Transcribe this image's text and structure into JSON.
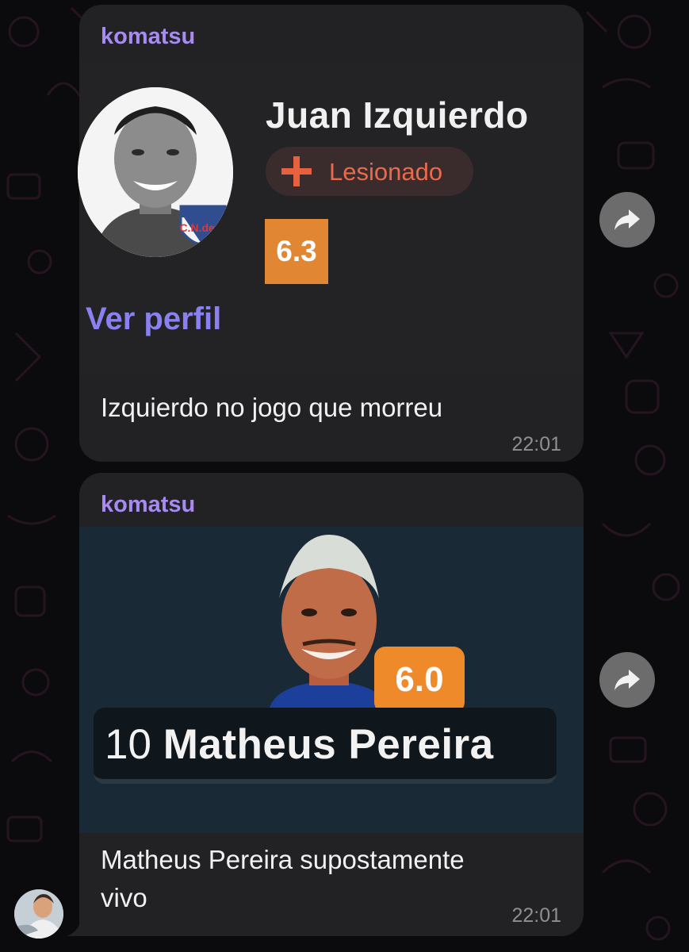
{
  "colors": {
    "background": "#0b0a0d",
    "bubble": "#222224",
    "sender_name": "#a78bf0",
    "rating_orange": "#e18734",
    "injury_red": "#ea6a49",
    "link_purple": "#8b80ef"
  },
  "messages": [
    {
      "sender": "komatsu",
      "card": {
        "player_name": "Juan Izquierdo",
        "status": "Lesionado",
        "status_icon": "plus-icon",
        "rating": "6.3",
        "club_badge": "C.N.de F.",
        "link": "Ver perfil"
      },
      "caption": "Izquierdo no jogo que morreu",
      "time": "22:01"
    },
    {
      "sender": "komatsu",
      "card": {
        "rating": "6.0",
        "shirt_number": "10",
        "player_name": "Matheus Pereira"
      },
      "caption_lines": [
        "Matheus Pereira supostamente",
        "vivo"
      ],
      "time": "22:01"
    }
  ],
  "icons": {
    "forward": "forward-arrow-icon"
  }
}
